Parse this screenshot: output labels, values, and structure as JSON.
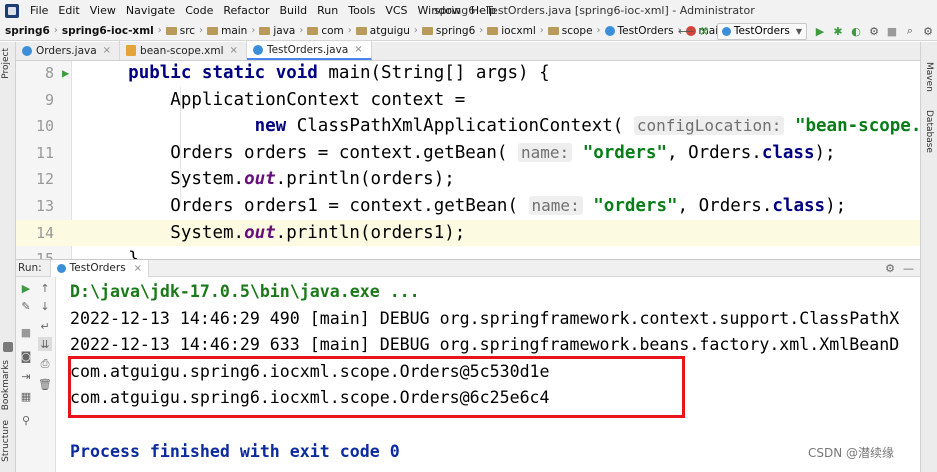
{
  "menu": {
    "items": [
      "File",
      "Edit",
      "View",
      "Navigate",
      "Code",
      "Refactor",
      "Build",
      "Run",
      "Tools",
      "VCS",
      "Window",
      "Help"
    ],
    "window_title": "spring6 - TestOrders.java [spring6-ioc-xml] - Administrator"
  },
  "breadcrumb": {
    "items": [
      "spring6",
      "spring6-ioc-xml",
      "src",
      "main",
      "java",
      "com",
      "atguigu",
      "spring6",
      "iocxml",
      "scope",
      "TestOrders",
      "main"
    ]
  },
  "toolbar": {
    "run_config": "TestOrders"
  },
  "tabs": [
    {
      "label": "Orders.java",
      "type": "class"
    },
    {
      "label": "bean-scope.xml",
      "type": "xml"
    },
    {
      "label": "TestOrders.java",
      "type": "class"
    }
  ],
  "left_strip": {
    "project": "Project",
    "bookmarks": "Bookmarks",
    "structure": "Structure"
  },
  "right_strip": {
    "maven": "Maven",
    "database": "Database"
  },
  "editor": {
    "lines": [
      {
        "num": "8",
        "indent": "    ",
        "parts": [
          [
            "kw",
            "public "
          ],
          [
            "kw",
            "static "
          ],
          [
            "kw",
            "void "
          ],
          [
            "",
            "main(String[] args) {"
          ]
        ]
      },
      {
        "num": "9",
        "indent": "        ",
        "parts": [
          [
            "",
            "ApplicationContext context ="
          ]
        ]
      },
      {
        "num": "10",
        "indent": "                ",
        "parts": [
          [
            "kw",
            "new "
          ],
          [
            "",
            "ClassPathXmlApplicationContext( "
          ],
          [
            "hint",
            "configLocation:"
          ],
          [
            "",
            " "
          ],
          [
            "str",
            "\"bean-scope.xml\""
          ]
        ]
      },
      {
        "num": "11",
        "indent": "        ",
        "parts": [
          [
            "",
            "Orders orders = context.getBean( "
          ],
          [
            "hint",
            "name:"
          ],
          [
            "",
            " "
          ],
          [
            "str",
            "\"orders\""
          ],
          [
            "",
            ", Orders."
          ],
          [
            "kw",
            "class"
          ],
          [
            "",
            ");"
          ]
        ]
      },
      {
        "num": "12",
        "indent": "        ",
        "parts": [
          [
            "",
            "System."
          ],
          [
            "it",
            "out"
          ],
          [
            "",
            ".println(orders);"
          ]
        ]
      },
      {
        "num": "13",
        "indent": "        ",
        "parts": [
          [
            "",
            "Orders orders1 = context.getBean( "
          ],
          [
            "hint",
            "name:"
          ],
          [
            "",
            " "
          ],
          [
            "str",
            "\"orders\""
          ],
          [
            "",
            ", Orders."
          ],
          [
            "kw",
            "class"
          ],
          [
            "",
            ");"
          ]
        ]
      },
      {
        "num": "14",
        "indent": "        ",
        "parts": [
          [
            "",
            "System."
          ],
          [
            "it",
            "out"
          ],
          [
            "",
            ".println(orders1);"
          ]
        ]
      },
      {
        "num": "15",
        "indent": "    ",
        "parts": [
          [
            "",
            "}"
          ]
        ]
      }
    ]
  },
  "run_panel": {
    "label": "Run:",
    "tab": "TestOrders"
  },
  "console": {
    "lines": [
      {
        "text": "D:\\java\\jdk-17.0.5\\bin\\java.exe ...",
        "kind": "cmd"
      },
      {
        "text": "2022-12-13 14:46:29 490 [main] DEBUG org.springframework.context.support.ClassPathX",
        "kind": ""
      },
      {
        "text": "2022-12-13 14:46:29 633 [main] DEBUG org.springframework.beans.factory.xml.XmlBeanD",
        "kind": ""
      },
      {
        "text": "com.atguigu.spring6.iocxml.scope.Orders@5c530d1e",
        "kind": ""
      },
      {
        "text": "com.atguigu.spring6.iocxml.scope.Orders@6c25e6c4",
        "kind": ""
      },
      {
        "text": "",
        "kind": ""
      },
      {
        "text": "Process finished with exit code 0",
        "kind": "done"
      }
    ]
  },
  "watermark": "CSDN @潜续缘",
  "colors": {
    "keyword": "#000080",
    "string": "#067d17",
    "static_field": "#660e7a",
    "highlight_box": "#e8141a",
    "current_line": "#fcfae1"
  }
}
